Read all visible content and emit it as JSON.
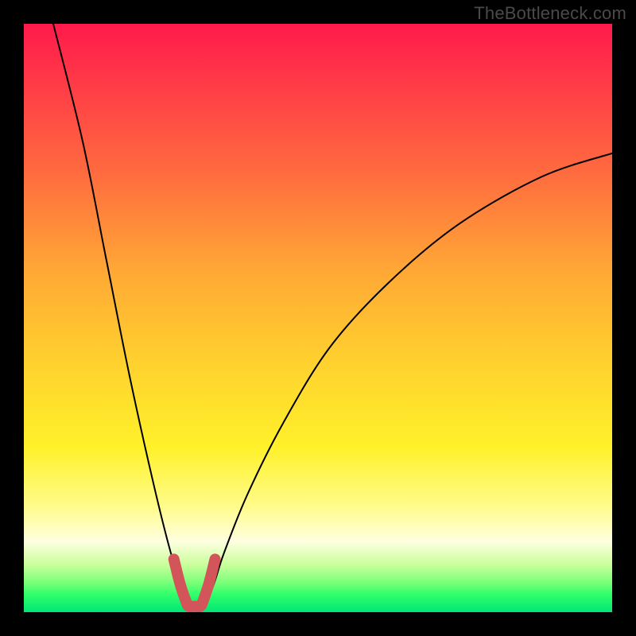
{
  "watermark": {
    "text": "TheBottleneck.com"
  },
  "chart_data": {
    "type": "line",
    "title": "",
    "xlabel": "",
    "ylabel": "",
    "xlim": [
      0,
      100
    ],
    "ylim": [
      0,
      100
    ],
    "grid": false,
    "legend": false,
    "series": [
      {
        "name": "bottleneck-curve",
        "x": [
          5,
          10,
          14,
          18,
          22,
          25,
          27,
          28.5,
          30,
          32,
          34,
          38,
          44,
          52,
          62,
          74,
          88,
          100
        ],
        "values": [
          100,
          80,
          60,
          40,
          22,
          10,
          4,
          1,
          1,
          4,
          10,
          20,
          32,
          45,
          56,
          66,
          74,
          78
        ]
      },
      {
        "name": "valley-highlight",
        "x": [
          25.5,
          26.5,
          27.5,
          28.0,
          29.0,
          30.0,
          30.5,
          31.5,
          32.5
        ],
        "values": [
          9,
          5,
          2,
          1,
          1,
          1,
          2,
          5,
          9
        ]
      }
    ],
    "background_gradient_stops": [
      {
        "offset": 0,
        "color": "#ff1a4b"
      },
      {
        "offset": 10,
        "color": "#ff3a47"
      },
      {
        "offset": 25,
        "color": "#ff6a3f"
      },
      {
        "offset": 42,
        "color": "#ffa835"
      },
      {
        "offset": 58,
        "color": "#ffd22e"
      },
      {
        "offset": 72,
        "color": "#fff12a"
      },
      {
        "offset": 82,
        "color": "#fffc8a"
      },
      {
        "offset": 88,
        "color": "#ffffe0"
      },
      {
        "offset": 92,
        "color": "#c8ff9a"
      },
      {
        "offset": 95,
        "color": "#7aff7a"
      },
      {
        "offset": 97,
        "color": "#2fff6a"
      },
      {
        "offset": 100,
        "color": "#00e676"
      }
    ]
  }
}
